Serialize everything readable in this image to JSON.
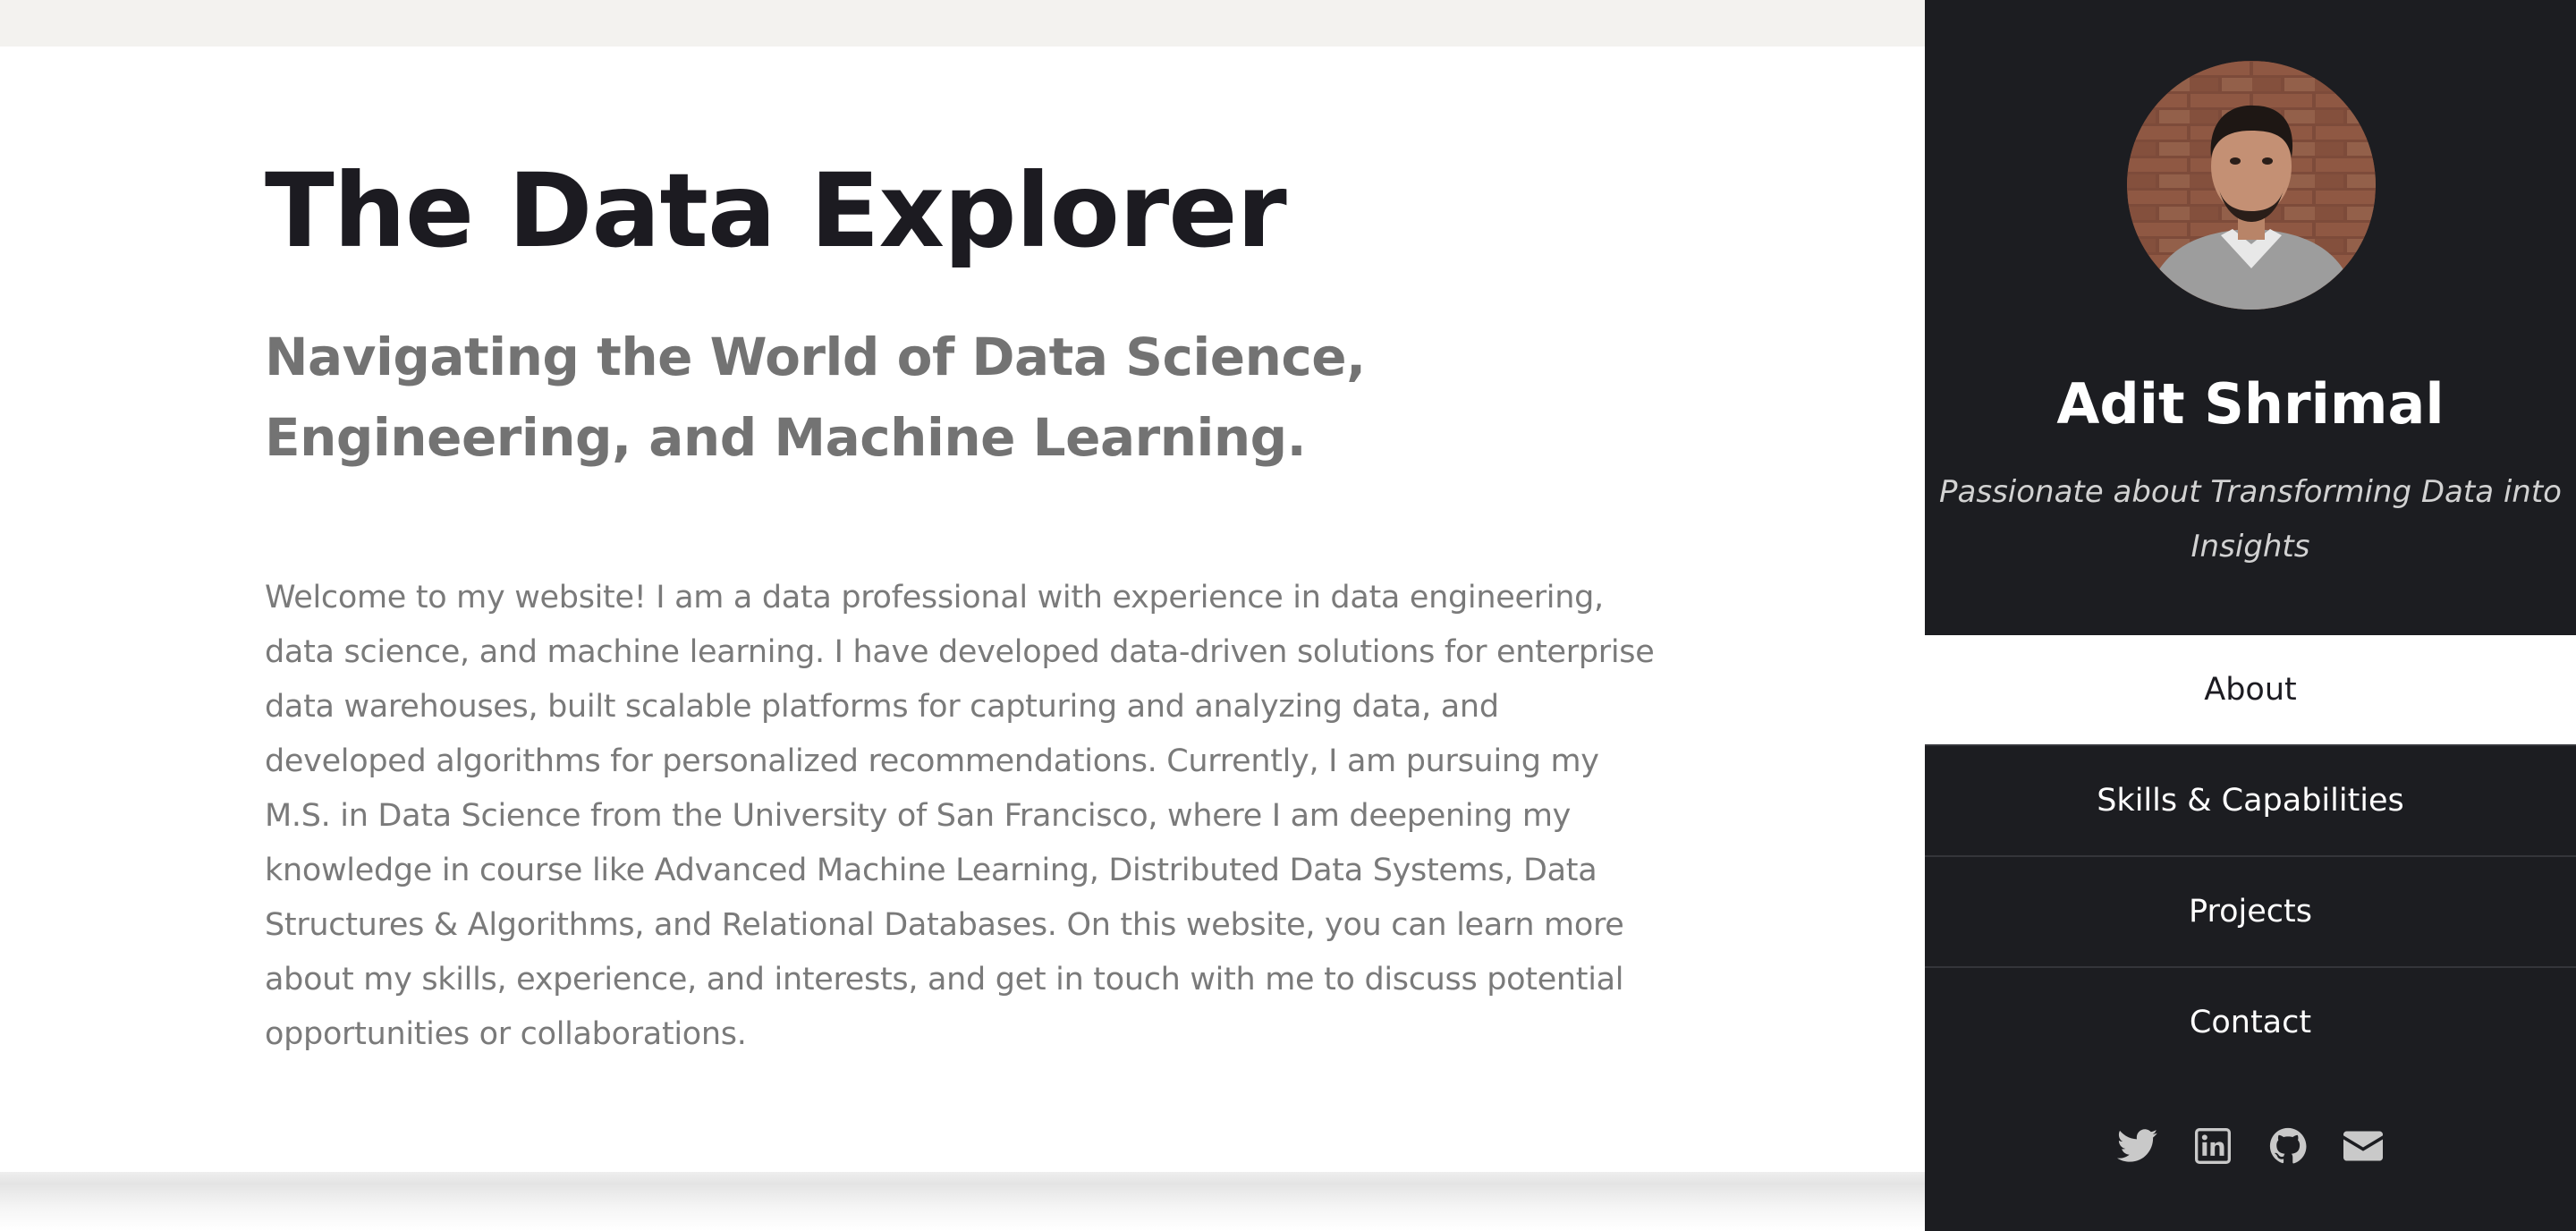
{
  "main": {
    "title": "The Data Explorer",
    "tagline": "Navigating the World of Data Science, Engineering, and Machine Learning.",
    "intro": "Welcome to my website! I am a data professional with experience in data engineering, data science, and machine learning. I have developed data-driven solutions for enterprise data warehouses, built scalable platforms for capturing and analyzing data, and developed algorithms for personalized recommendations. Currently, I am pursuing my M.S. in Data Science from the University of San Francisco, where I am deepening my knowledge in course like Advanced Machine Learning, Distributed Data Systems, Data Structures & Algorithms, and Relational Databases. On this website, you can learn more about my skills, experience, and interests, and get in touch with me to discuss potential opportunities or collaborations."
  },
  "sidebar": {
    "name": "Adit Shrimal",
    "tagline": "Passionate about Transforming Data into Insights",
    "nav": [
      {
        "label": "About"
      },
      {
        "label": "Skills & Capabilities"
      },
      {
        "label": "Projects"
      },
      {
        "label": "Contact"
      }
    ],
    "social": [
      "twitter-icon",
      "linkedin-icon",
      "github-icon",
      "email-icon"
    ]
  },
  "colors": {
    "sidebar_bg": "#1c1d21",
    "title": "#1c1b21",
    "tagline": "#737373",
    "body_text": "#7a7a7a",
    "social_icon": "#c9c9c9"
  }
}
